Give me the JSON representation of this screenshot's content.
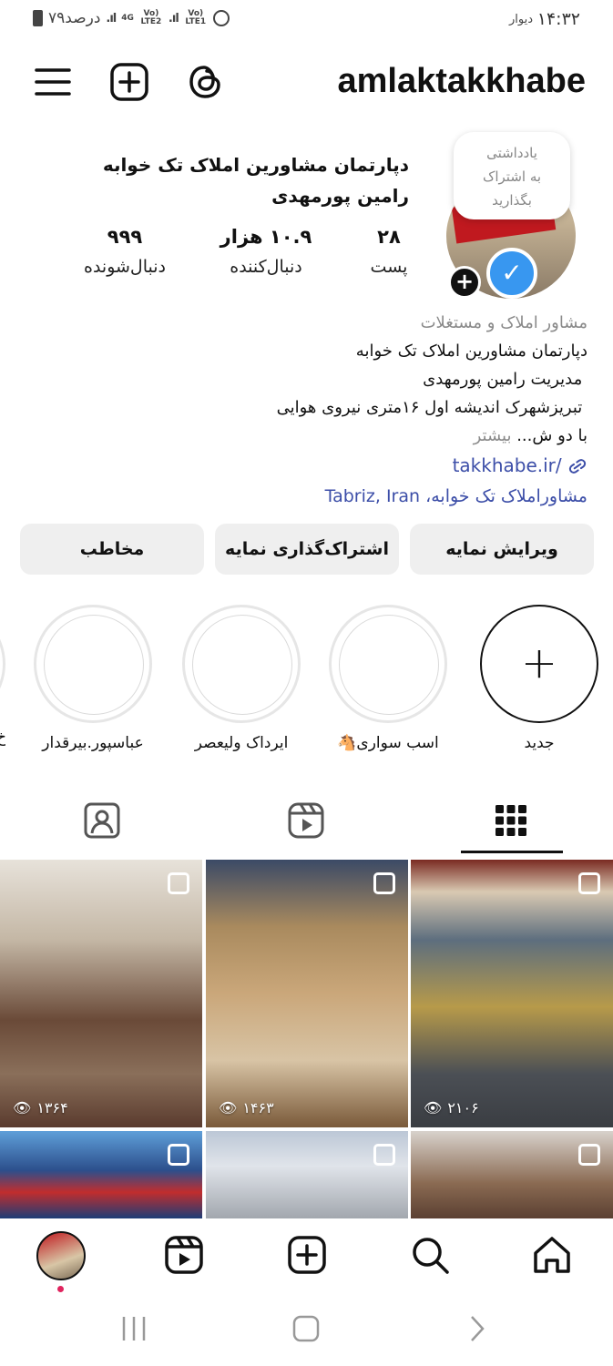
{
  "status_bar": {
    "time": "۱۴:۳۲",
    "carrier": "دیوار",
    "battery_text": "۷۹درصد",
    "net1": "4G",
    "volte1": "Vo) LTE2",
    "volte2": "Vo) LTE1"
  },
  "header": {
    "username": "amlaktakkhabe",
    "icons": [
      "threads-icon",
      "new-post-icon",
      "menu-icon"
    ]
  },
  "profile": {
    "note_line1": "یادداشتی",
    "note_line2": "به اشتراک",
    "note_line3": "بگذارید",
    "full_name": "دپارتمان مشاورین املاک تک خوابه رامین پورمهدی",
    "stats": {
      "posts_value": "۲۸",
      "posts_label": "پست",
      "followers_value": "۱۰.۹ هزار",
      "followers_label": "دنبال‌کننده",
      "following_value": "۹۹۹",
      "following_label": "دنبال‌شونده"
    },
    "category": "مشاور املاک و مستغلات",
    "bio_line1": "دپارتمان مشاورین املاک تک خوابه",
    "bio_line2": " مدیریت رامین پورمهدی",
    "bio_line3": " تبریزشهرک اندیشه اول ۱۶متری نیروی هوایی",
    "bio_line4": "با دو ش... ",
    "bio_more": "بیشتر",
    "link": "takkhabe.ir/",
    "location": "مشاوراملاک تک خوابه، Tabriz, Iran"
  },
  "actions": {
    "edit_label": "ویرایش نمایه",
    "share_label": "اشتراک‌گذاری نمایه",
    "contact_label": "مخاطب"
  },
  "highlights": {
    "new_label": "جدید",
    "items": [
      {
        "label": "اسب سواری🐴"
      },
      {
        "label": "ایرداک ولیعصر"
      },
      {
        "label": "عباسپور.بیرقدار"
      }
    ],
    "partial_label": "خ"
  },
  "tabs": [
    "grid-icon",
    "reels-icon",
    "tagged-icon"
  ],
  "posts": [
    {
      "views": "۲۱۰۶"
    },
    {
      "views": "۱۴۶۳"
    },
    {
      "views": "۱۳۶۴"
    },
    {
      "views": ""
    },
    {
      "views": ""
    },
    {
      "views": ""
    }
  ],
  "colors": {
    "link": "#3c4ea8",
    "verified": "#3897f0",
    "button_bg": "#efefef"
  }
}
